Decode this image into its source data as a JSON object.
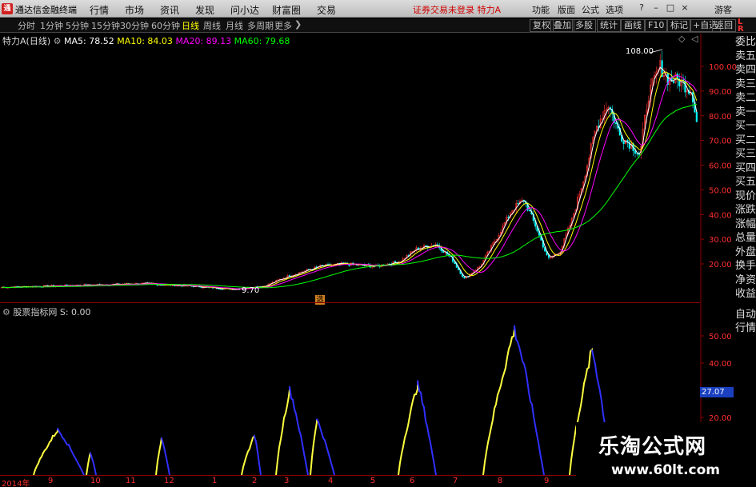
{
  "app": {
    "title": "通达信金融终端",
    "login": "游客",
    "alert": "证券交易未登录 特力A"
  },
  "menu": [
    "行情",
    "市场",
    "资讯",
    "发现",
    "问小达",
    "财富圈",
    "交易"
  ],
  "right_menu": [
    "功能",
    "版面",
    "公式",
    "选项"
  ],
  "periods": [
    "分时",
    "1分钟",
    "5分钟",
    "15分钟",
    "30分钟",
    "60分钟",
    "日线",
    "周线",
    "月线",
    "多周期",
    "更多"
  ],
  "active_period": "日线",
  "tools": [
    "复权",
    "叠加",
    "多股",
    "统计",
    "画线",
    "F10",
    "标记",
    "+自选",
    "返回"
  ],
  "lr_badge": [
    "L",
    "R"
  ],
  "main_legend": {
    "name": "特力A",
    "period": "(日线)",
    "ma5": "MA5: 78.52",
    "ma10": "MA10: 84.03",
    "ma20": "MA20: 89.13",
    "ma60": "MA60: 79.68"
  },
  "colors": {
    "ma5": "#ffffff",
    "ma10": "#ffff00",
    "ma20": "#ff00ff",
    "ma60": "#00ff00",
    "up": "#ff3030",
    "down": "#00ffff",
    "ind_up": "#ffff40",
    "ind_down": "#3030ff"
  },
  "price_axis": [
    "100.00",
    "90.00",
    "80.00",
    "70.00",
    "60.00",
    "50.00",
    "40.00",
    "30.00",
    "20.00"
  ],
  "annotations": {
    "high": "108.00",
    "low": "9.70",
    "tag": "选"
  },
  "indicator": {
    "title": "股票指标网",
    "value": "S: 0.00",
    "axis": [
      "50.00",
      "40.00",
      "20.00"
    ],
    "current": "27.07"
  },
  "right_panel": [
    "委比",
    "卖五",
    "卖四",
    "卖三",
    "卖二",
    "卖一",
    "买一",
    "买二",
    "买三",
    "买四",
    "买五",
    "现价",
    "涨跌",
    "涨幅",
    "总量",
    "外盘",
    "换手",
    "净资",
    "收益"
  ],
  "right_panel2": [
    "自动",
    "行情"
  ],
  "time_axis": [
    "2014年",
    "9",
    "10",
    "11",
    "12",
    "1",
    "2",
    "3",
    "4",
    "5",
    "6",
    "7",
    "8",
    "9"
  ],
  "watermark": {
    "cn": "乐淘公式网",
    "url": "www.60lt.com"
  }
}
